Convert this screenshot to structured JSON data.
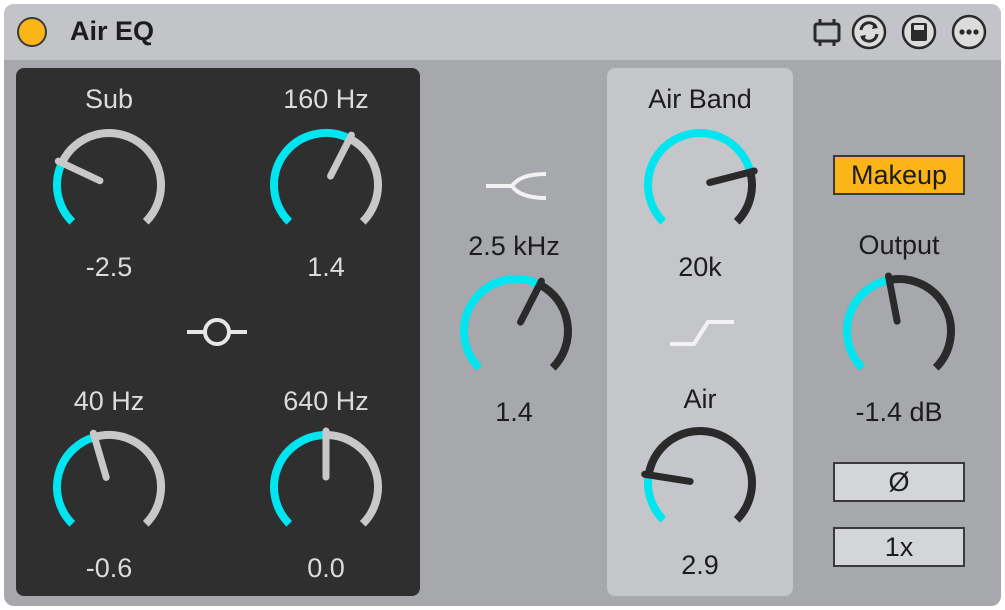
{
  "device": {
    "title": "Air EQ"
  },
  "titlebar_icons": [
    "device-clip-icon",
    "sync-icon",
    "save-icon",
    "more-icon"
  ],
  "colors": {
    "accent": "#00e5f0",
    "makeup": "#fbb519",
    "power": "#fbb519"
  },
  "knobs": [
    {
      "id": "sub",
      "label": "Sub",
      "value": "-2.5",
      "level": 0.26
    },
    {
      "id": "160hz",
      "label": "160 Hz",
      "value": "1.4",
      "level": 0.6
    },
    {
      "id": "40hz",
      "label": "40 Hz",
      "value": "-0.6",
      "level": 0.44
    },
    {
      "id": "640hz",
      "label": "640 Hz",
      "value": "0.0",
      "level": 0.5
    },
    {
      "id": "mid",
      "label": "2.5 kHz",
      "value": "1.4",
      "level": 0.6
    },
    {
      "id": "airband",
      "label": "Air Band",
      "value": "20k",
      "level": 0.78
    },
    {
      "id": "air",
      "label": "Air",
      "value": "2.9",
      "level": 0.2
    },
    {
      "id": "output",
      "label": "Output",
      "value": "-1.4 dB",
      "level": 0.46
    }
  ],
  "buttons": {
    "makeup": "Makeup",
    "phase": "Ø",
    "oversample": "1x"
  }
}
